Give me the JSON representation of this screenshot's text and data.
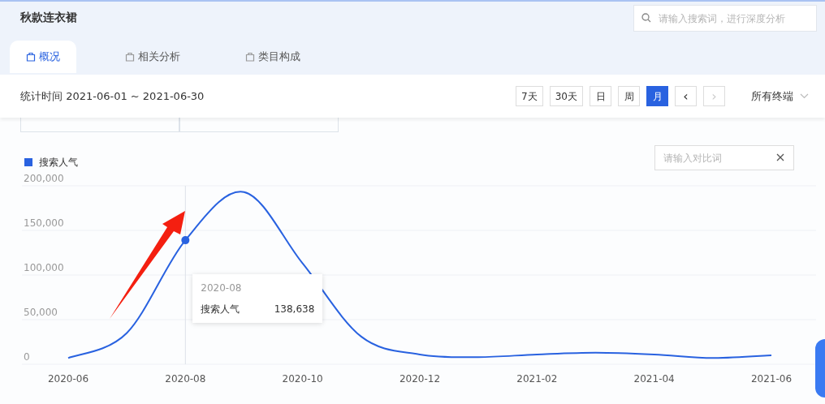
{
  "header": {
    "title": "秋款连衣裙",
    "search": {
      "placeholder": "请输入搜索词，进行深度分析"
    }
  },
  "tabs": [
    {
      "label": "概况",
      "selected": true
    },
    {
      "label": "相关分析",
      "selected": false
    },
    {
      "label": "类目构成",
      "selected": false
    }
  ],
  "filter_bar": {
    "period_label": "统计时间 2021-06-01 ~ 2021-06-30",
    "ranges": [
      {
        "label": "7天",
        "selected": false
      },
      {
        "label": "30天",
        "selected": false
      },
      {
        "label": "日",
        "selected": false
      },
      {
        "label": "周",
        "selected": false
      },
      {
        "label": "月",
        "selected": true
      }
    ],
    "prev": {
      "label": "‹",
      "disabled": false
    },
    "next": {
      "label": "›",
      "disabled": true
    },
    "device": "所有终端"
  },
  "trend": {
    "compare": {
      "placeholder": "请输入对比词"
    },
    "chart_data": {
      "type": "line",
      "categories": [
        "2020-06",
        null,
        "2020-08",
        null,
        "2020-10",
        null,
        "2020-12",
        null,
        "2021-02",
        null,
        "2021-04",
        null,
        "2021-06"
      ],
      "series": [
        {
          "name": "搜索人气",
          "color": "#2962e0",
          "values": [
            7000,
            35000,
            139000,
            193000,
            113000,
            31000,
            11000,
            8000,
            11000,
            13000,
            11000,
            7000,
            10000
          ]
        }
      ],
      "ylim": [
        0,
        200000
      ],
      "yticks": [
        {
          "value": 0,
          "label": "0"
        },
        {
          "value": 50000,
          "label": "50,000"
        },
        {
          "value": 100000,
          "label": "100,000"
        },
        {
          "value": 150000,
          "label": "150,000"
        },
        {
          "value": 200000,
          "label": "200,000"
        }
      ],
      "grid": true,
      "ref_lines": [
        {
          "axis": "x",
          "value": "2020-08",
          "color": "#dde1e8"
        }
      ]
    },
    "tooltip": {
      "title": "2020-08",
      "series": "搜索人气",
      "value": "138,638"
    }
  }
}
